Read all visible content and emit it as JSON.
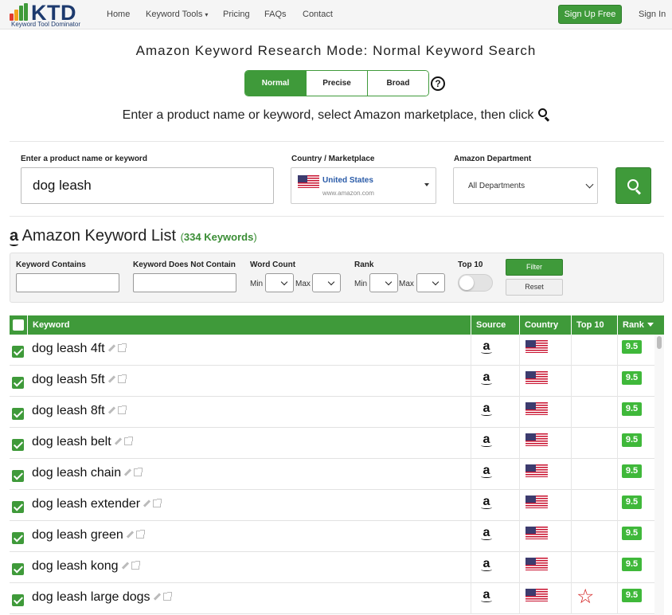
{
  "brand": {
    "logo_text": "KTD",
    "tagline": "Keyword Tool Dominator",
    "bar_colors": [
      "#e23b2e",
      "#f2a21b",
      "#3f9a3a"
    ]
  },
  "nav": {
    "home": "Home",
    "keyword_tools": "Keyword Tools",
    "pricing": "Pricing",
    "faqs": "FAQs",
    "contact": "Contact",
    "signup": "Sign Up Free",
    "signin": "Sign In"
  },
  "page": {
    "title": "Amazon Keyword Research Mode: Normal Keyword Search",
    "instruction": "Enter a product name or keyword, select Amazon marketplace, then click"
  },
  "modes": [
    {
      "label": "Normal",
      "active": true
    },
    {
      "label": "Precise",
      "active": false
    },
    {
      "label": "Broad",
      "active": false
    }
  ],
  "help_glyph": "?",
  "search": {
    "keyword_label": "Enter a product name or keyword",
    "keyword_value": "dog leash",
    "country_label": "Country / Marketplace",
    "country_name": "United States",
    "country_domain": "www.amazon.com",
    "department_label": "Amazon Department",
    "department_value": "All Departments"
  },
  "list": {
    "title": "Amazon Keyword List",
    "count": "334 Keywords",
    "amazon_glyph": "a"
  },
  "filters": {
    "contains_label": "Keyword Contains",
    "not_contains_label": "Keyword Does Not Contain",
    "word_count_label": "Word Count",
    "rank_label": "Rank",
    "top10_label": "Top 10",
    "min_label": "Min",
    "max_label": "Max",
    "filter_btn": "Filter",
    "reset_btn": "Reset",
    "top10_enabled": false
  },
  "table": {
    "headers": {
      "keyword": "Keyword",
      "source": "Source",
      "country": "Country",
      "top10": "Top 10",
      "rank": "Rank"
    },
    "rows": [
      {
        "keyword": "dog leash 4ft",
        "rank": "9.5",
        "top10": false
      },
      {
        "keyword": "dog leash 5ft",
        "rank": "9.5",
        "top10": false
      },
      {
        "keyword": "dog leash 8ft",
        "rank": "9.5",
        "top10": false
      },
      {
        "keyword": "dog leash belt",
        "rank": "9.5",
        "top10": false
      },
      {
        "keyword": "dog leash chain",
        "rank": "9.5",
        "top10": false
      },
      {
        "keyword": "dog leash extender",
        "rank": "9.5",
        "top10": false
      },
      {
        "keyword": "dog leash green",
        "rank": "9.5",
        "top10": false
      },
      {
        "keyword": "dog leash kong",
        "rank": "9.5",
        "top10": false
      },
      {
        "keyword": "dog leash large dogs",
        "rank": "9.5",
        "top10": true
      }
    ],
    "source_glyph": "a",
    "star_glyph": "☆"
  },
  "colors": {
    "accent_green": "#3f9a3a",
    "rank_green": "#3fb83a",
    "star_red": "#d21b1b",
    "link_blue": "#2a5ba8"
  }
}
